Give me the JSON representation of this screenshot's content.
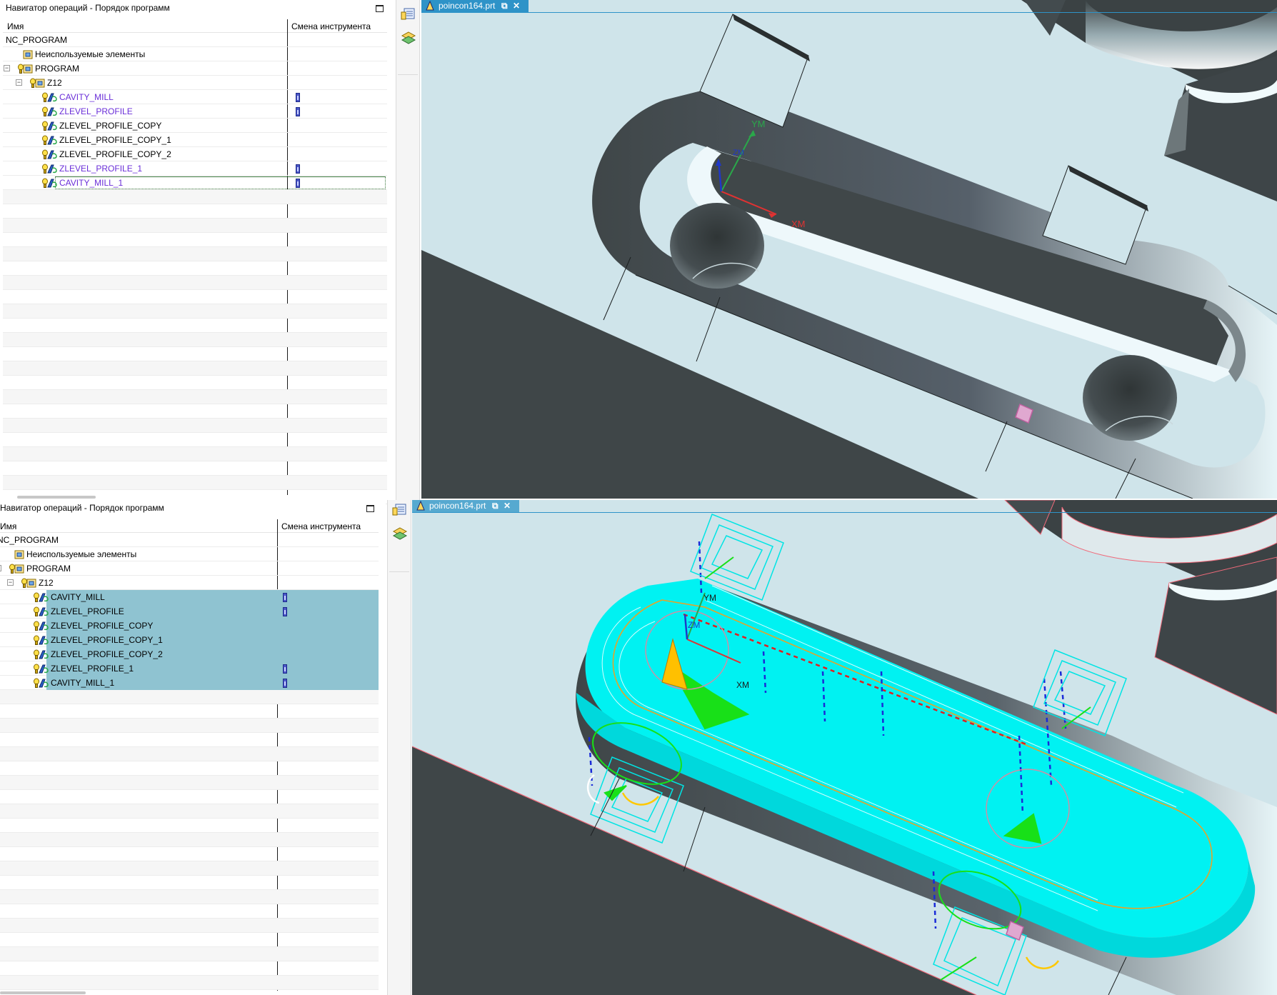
{
  "panels": [
    {
      "title": "Навигатор операций - Порядок программ",
      "columns": {
        "name": "Имя",
        "tool_change": "Смена инструмента"
      },
      "tree": [
        {
          "label": "NC_PROGRAM",
          "color": "#000000",
          "selected": false,
          "tool_change_marker": false
        },
        {
          "label": "Неиспользуемые элементы",
          "color": "#000000",
          "selected": false,
          "tool_change_marker": false
        },
        {
          "label": "PROGRAM",
          "color": "#000000",
          "selected": false,
          "tool_change_marker": false
        },
        {
          "label": "Z12",
          "color": "#000000",
          "selected": false,
          "tool_change_marker": false
        },
        {
          "label": "CAVITY_MILL",
          "color": "#6a2ed8",
          "selected": false,
          "tool_change_marker": true
        },
        {
          "label": "ZLEVEL_PROFILE",
          "color": "#6a2ed8",
          "selected": false,
          "tool_change_marker": true
        },
        {
          "label": "ZLEVEL_PROFILE_COPY",
          "color": "#000000",
          "selected": false,
          "tool_change_marker": false
        },
        {
          "label": "ZLEVEL_PROFILE_COPY_1",
          "color": "#000000",
          "selected": false,
          "tool_change_marker": false
        },
        {
          "label": "ZLEVEL_PROFILE_COPY_2",
          "color": "#000000",
          "selected": false,
          "tool_change_marker": false
        },
        {
          "label": "ZLEVEL_PROFILE_1",
          "color": "#6a2ed8",
          "selected": false,
          "tool_change_marker": true
        },
        {
          "label": "CAVITY_MILL_1",
          "color": "#6a2ed8",
          "selected": false,
          "tool_change_marker": true,
          "focused": true
        }
      ],
      "viewport": {
        "tab_label": "poincon164.prt",
        "axes": {
          "x": "XM",
          "y": "YM",
          "z": "ZM"
        },
        "shows_toolpaths": false
      }
    },
    {
      "title": "Навигатор операций - Порядок программ",
      "columns": {
        "name": "Имя",
        "tool_change": "Смена инструмента"
      },
      "tree": [
        {
          "label": "NC_PROGRAM",
          "color": "#000000",
          "selected": false,
          "tool_change_marker": false
        },
        {
          "label": "Неиспользуемые элементы",
          "color": "#000000",
          "selected": false,
          "tool_change_marker": false
        },
        {
          "label": "PROGRAM",
          "color": "#000000",
          "selected": false,
          "tool_change_marker": false
        },
        {
          "label": "Z12",
          "color": "#000000",
          "selected": false,
          "tool_change_marker": false
        },
        {
          "label": "CAVITY_MILL",
          "color": "#000000",
          "selected": true,
          "tool_change_marker": true
        },
        {
          "label": "ZLEVEL_PROFILE",
          "color": "#000000",
          "selected": true,
          "tool_change_marker": true
        },
        {
          "label": "ZLEVEL_PROFILE_COPY",
          "color": "#000000",
          "selected": true,
          "tool_change_marker": false
        },
        {
          "label": "ZLEVEL_PROFILE_COPY_1",
          "color": "#000000",
          "selected": true,
          "tool_change_marker": false
        },
        {
          "label": "ZLEVEL_PROFILE_COPY_2",
          "color": "#000000",
          "selected": true,
          "tool_change_marker": false
        },
        {
          "label": "ZLEVEL_PROFILE_1",
          "color": "#000000",
          "selected": true,
          "tool_change_marker": true
        },
        {
          "label": "CAVITY_MILL_1",
          "color": "#000000",
          "selected": true,
          "tool_change_marker": true,
          "focused": true
        }
      ],
      "viewport": {
        "tab_label": "poincon164.prt",
        "axes": {
          "x": "XM",
          "y": "YM",
          "z": "ZM"
        },
        "shows_toolpaths": true
      }
    }
  ],
  "icons": {
    "maximize": "maximize-icon",
    "tab_part": "part-file-icon",
    "tab_undock": "undock-icon",
    "tab_close": "close-icon",
    "strip_1": "operation-navigator-icon",
    "strip_2": "layers-icon",
    "tree_program": "program-group-icon",
    "tree_operation": "operation-icon",
    "tree_status": "status-bulb-icon"
  },
  "colors": {
    "selection": "#8fc3d1",
    "modified_text": "#6a2ed8",
    "tab_active": "#2e93c8",
    "viewport_bg": "#cfe4ea",
    "part_dark": "#3f4648",
    "toolpath_fill": "#00f2f2"
  }
}
